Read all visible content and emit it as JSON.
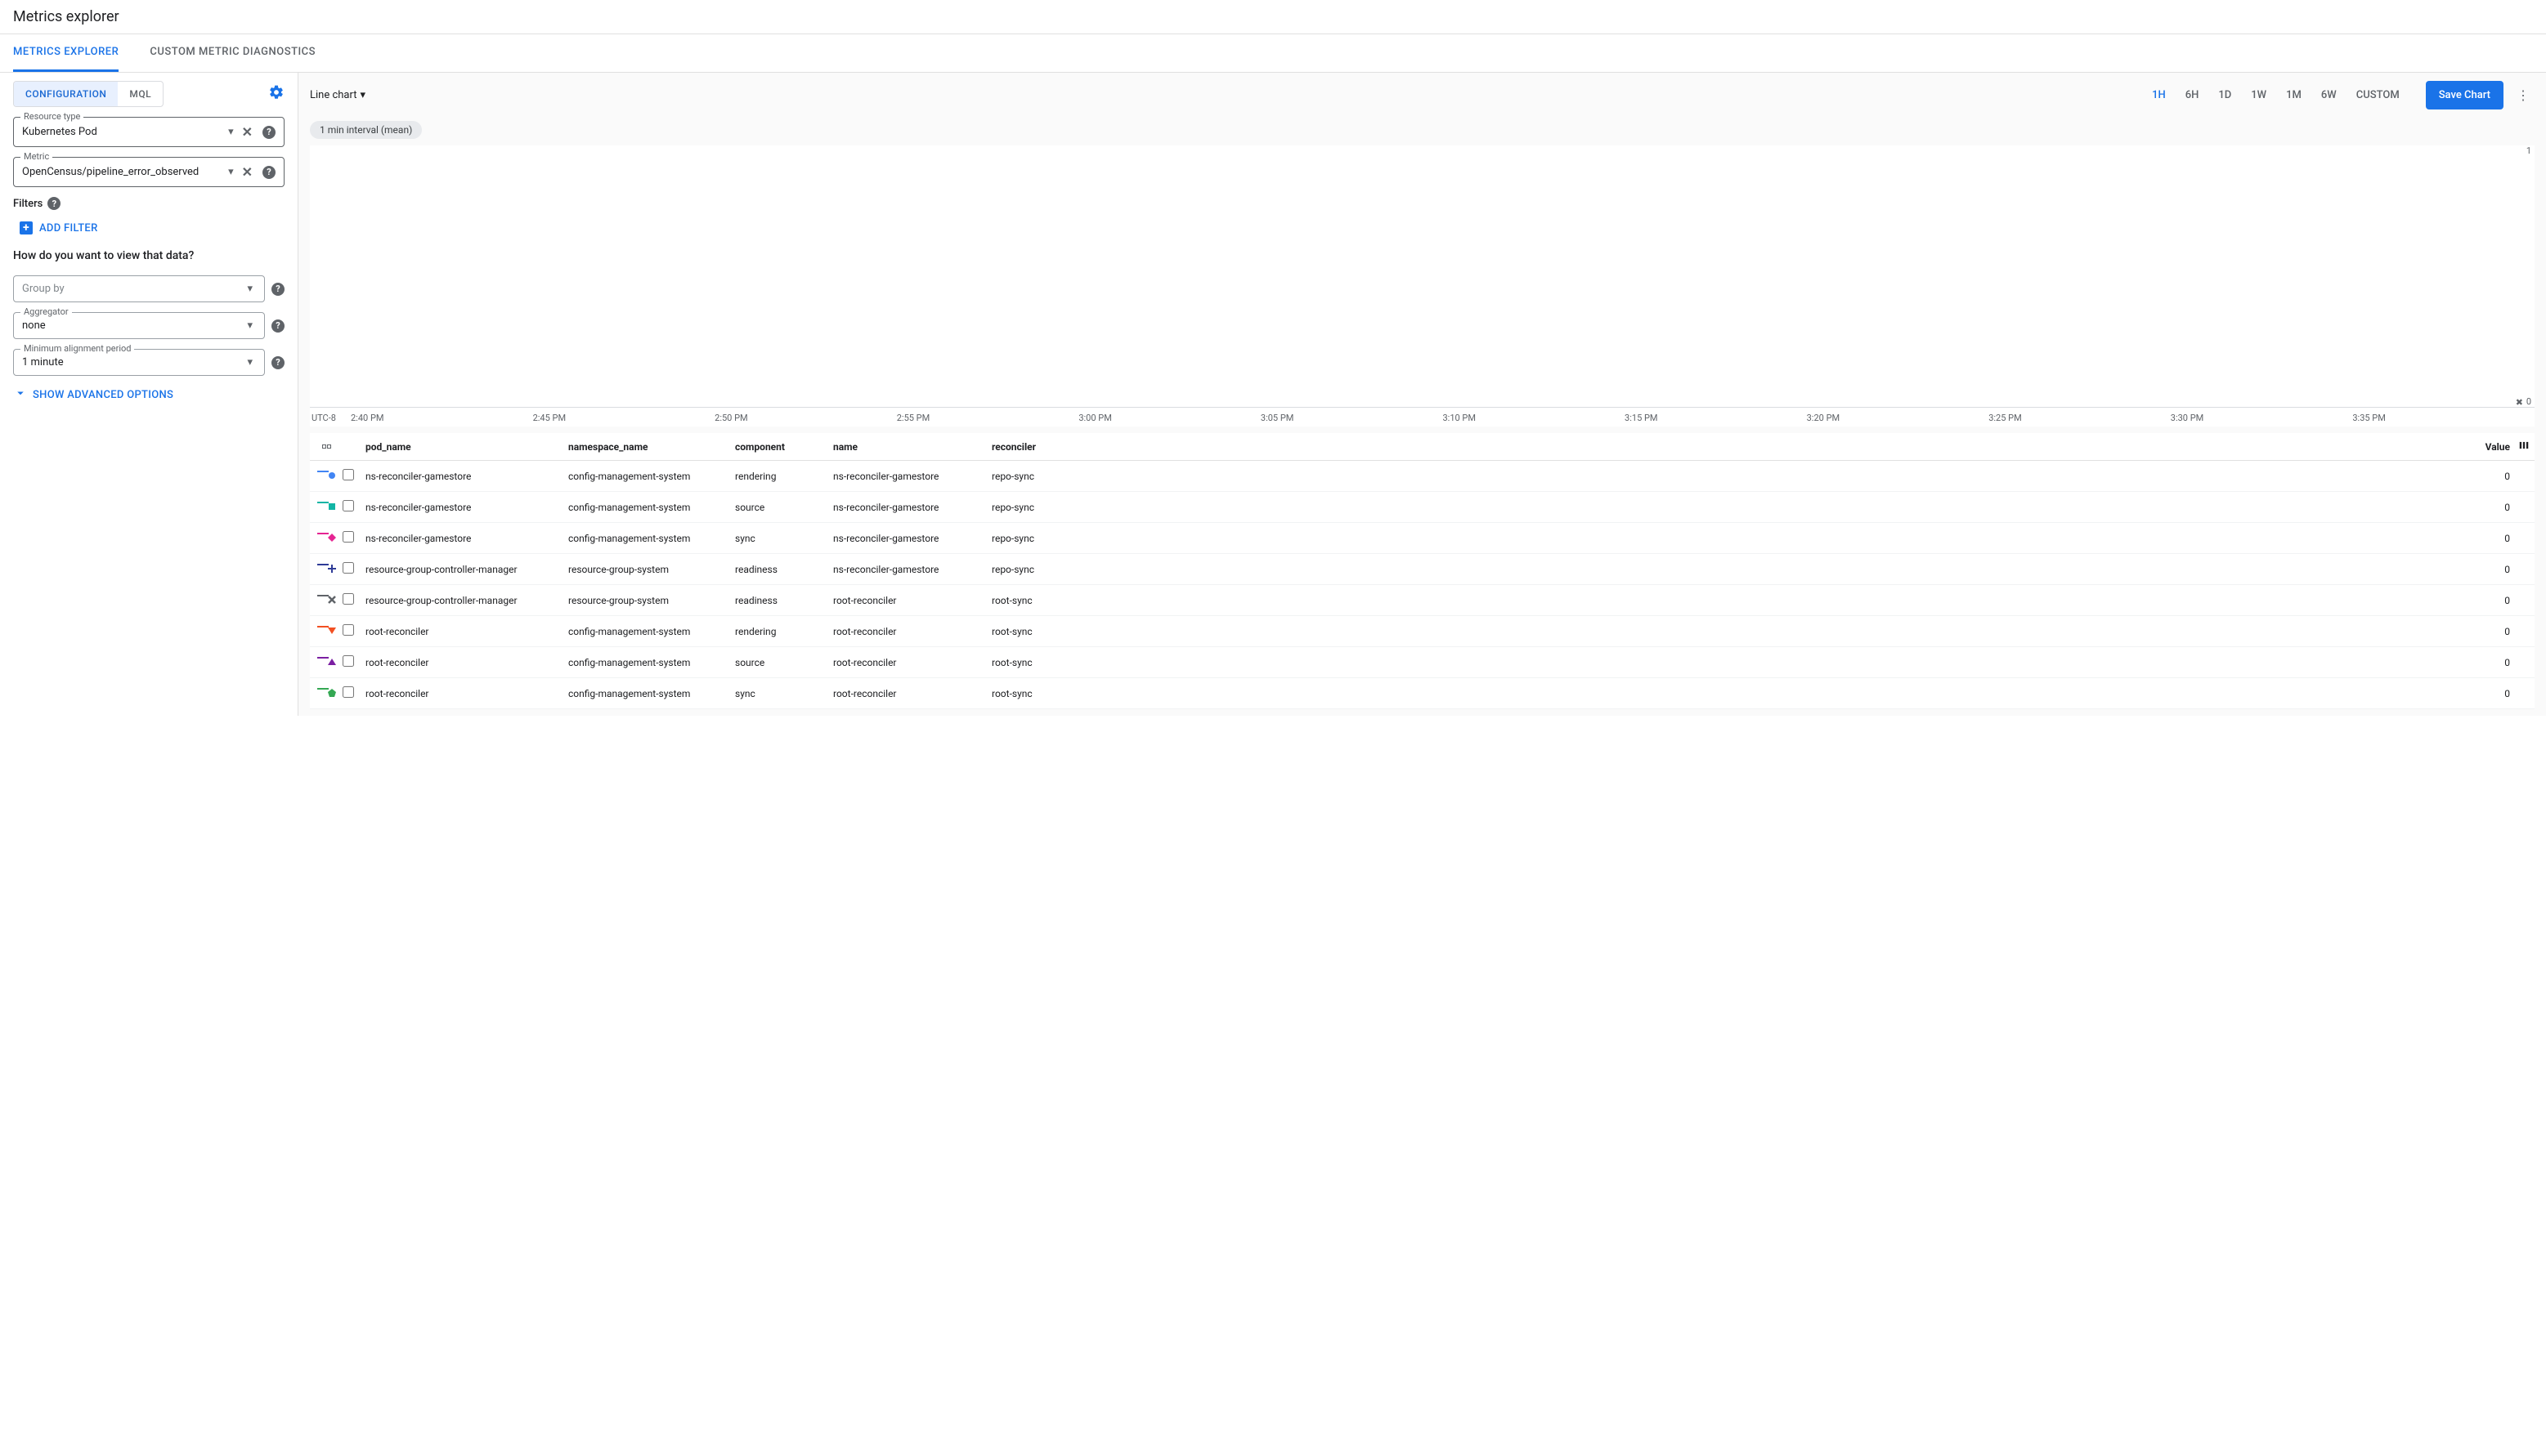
{
  "page_title": "Metrics explorer",
  "tabs": [
    "METRICS EXPLORER",
    "CUSTOM METRIC DIAGNOSTICS"
  ],
  "subtabs": [
    "CONFIGURATION",
    "MQL"
  ],
  "sidebar": {
    "resource_type_label": "Resource type",
    "resource_type_value": "Kubernetes Pod",
    "metric_label": "Metric",
    "metric_value": "OpenCensus/pipeline_error_observed",
    "filters_label": "Filters",
    "add_filter": "ADD FILTER",
    "view_question": "How do you want to view that data?",
    "groupby_placeholder": "Group by",
    "aggregator_label": "Aggregator",
    "aggregator_value": "none",
    "alignment_label": "Minimum alignment period",
    "alignment_value": "1 minute",
    "advanced": "SHOW ADVANCED OPTIONS"
  },
  "toolbar": {
    "chart_type": "Line chart",
    "ranges": [
      "1H",
      "6H",
      "1D",
      "1W",
      "1M",
      "6W",
      "CUSTOM"
    ],
    "active_range": "1H",
    "save": "Save Chart",
    "interval": "1 min interval (mean)"
  },
  "chart_data": {
    "type": "line",
    "y_max": "1",
    "y_min": "0",
    "timezone": "UTC-8",
    "x_ticks": [
      "2:40 PM",
      "2:45 PM",
      "2:50 PM",
      "2:55 PM",
      "3:00 PM",
      "3:05 PM",
      "3:10 PM",
      "3:15 PM",
      "3:20 PM",
      "3:25 PM",
      "3:30 PM",
      "3:35 PM"
    ],
    "series_all_zero": true
  },
  "legend": {
    "headers": {
      "pod": "pod_name",
      "ns": "namespace_name",
      "comp": "component",
      "name": "name",
      "rec": "reconciler",
      "val": "Value"
    },
    "rows": [
      {
        "color": "#4285f4",
        "shape": "circle",
        "pod": "ns-reconciler-gamestore",
        "ns": "config-management-system",
        "comp": "rendering",
        "name": "ns-reconciler-gamestore",
        "rec": "repo-sync",
        "val": "0"
      },
      {
        "color": "#12b5a5",
        "shape": "square",
        "pod": "ns-reconciler-gamestore",
        "ns": "config-management-system",
        "comp": "source",
        "name": "ns-reconciler-gamestore",
        "rec": "repo-sync",
        "val": "0"
      },
      {
        "color": "#e52592",
        "shape": "diamond",
        "pod": "ns-reconciler-gamestore",
        "ns": "config-management-system",
        "comp": "sync",
        "name": "ns-reconciler-gamestore",
        "rec": "repo-sync",
        "val": "0"
      },
      {
        "color": "#2e3b97",
        "shape": "plus",
        "pod": "resource-group-controller-manager",
        "ns": "resource-group-system",
        "comp": "readiness",
        "name": "ns-reconciler-gamestore",
        "rec": "repo-sync",
        "val": "0"
      },
      {
        "color": "#5f6368",
        "shape": "x",
        "pod": "resource-group-controller-manager",
        "ns": "resource-group-system",
        "comp": "readiness",
        "name": "root-reconciler",
        "rec": "root-sync",
        "val": "0"
      },
      {
        "color": "#f25022",
        "shape": "tri-down",
        "pod": "root-reconciler",
        "ns": "config-management-system",
        "comp": "rendering",
        "name": "root-reconciler",
        "rec": "root-sync",
        "val": "0"
      },
      {
        "color": "#7b1fa2",
        "shape": "tri-up",
        "pod": "root-reconciler",
        "ns": "config-management-system",
        "comp": "source",
        "name": "root-reconciler",
        "rec": "root-sync",
        "val": "0"
      },
      {
        "color": "#34a853",
        "shape": "pentagon",
        "pod": "root-reconciler",
        "ns": "config-management-system",
        "comp": "sync",
        "name": "root-reconciler",
        "rec": "root-sync",
        "val": "0"
      }
    ]
  }
}
